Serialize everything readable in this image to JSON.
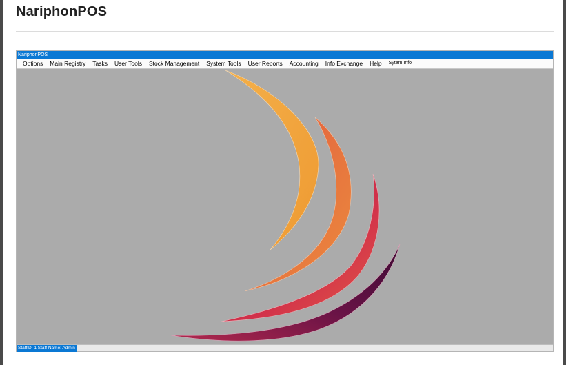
{
  "page": {
    "title": "NariphonPOS"
  },
  "app": {
    "window_title": "NariphonPOS",
    "menu": [
      {
        "label": "Options"
      },
      {
        "label": "Main Registry"
      },
      {
        "label": "Tasks"
      },
      {
        "label": "User Tools"
      },
      {
        "label": "Stock Management"
      },
      {
        "label": "System Tools"
      },
      {
        "label": "User Reports"
      },
      {
        "label": "Accounting"
      },
      {
        "label": "Info Exchange"
      },
      {
        "label": "Help"
      },
      {
        "label": "Sytem Info"
      }
    ],
    "status": {
      "text": "StaffID:  1  Staff Name:  Admin"
    },
    "logo": {
      "icon": "sail-swoosh-logo"
    }
  },
  "colors": {
    "titlebar": "#0a78d4",
    "workspace": "#ababab",
    "swoosh_1": "#f2a33a",
    "swoosh_2": "#e0643f",
    "swoosh_3": "#c2204a",
    "swoosh_4": "#5e1244"
  }
}
